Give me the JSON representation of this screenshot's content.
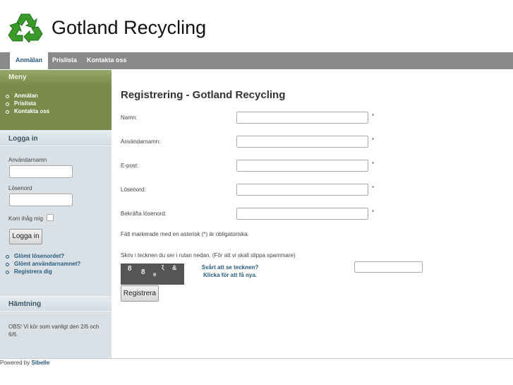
{
  "header": {
    "title": "Gotland Recycling",
    "logo": "recycling-logo"
  },
  "nav": {
    "tabs": [
      {
        "label": "Anmälan",
        "active": true
      },
      {
        "label": "Prislista"
      },
      {
        "label": "Kontakta oss"
      }
    ]
  },
  "sidebar": {
    "menu": {
      "title": "Meny",
      "items": [
        "Anmälan",
        "Prislista",
        "Kontakta oss"
      ]
    },
    "login": {
      "title": "Logga in",
      "username_label": "Användarnamn",
      "username_value": "",
      "password_label": "Lösenord",
      "password_value": "",
      "remember_label": "Kom ihåg mig",
      "remember_checked": false,
      "submit_label": "Logga in",
      "links": [
        "Glömt lösenordet?",
        "Glömt användarnamnet?",
        "Registrera dig"
      ]
    },
    "pickup": {
      "title": "Hämtning",
      "text": "OBS! Vi kör som vanligt den 2/6 och 6/6."
    }
  },
  "main": {
    "title": "Registrering - Gotland Recycling",
    "fields": [
      {
        "label": "Namn:",
        "value": "",
        "required": "*"
      },
      {
        "label": "Användarnamn:",
        "value": "",
        "required": "*"
      },
      {
        "label": "E-post:",
        "value": "",
        "required": "*"
      },
      {
        "label": "Lösenord:",
        "value": "",
        "required": "*"
      },
      {
        "label": "Bekräfta lösenord:",
        "value": "",
        "required": "*"
      }
    ],
    "required_note": "Fält markerade med en asterisk (*) är obligatoriska.",
    "captcha_instruction": "Skriv i tecknen du ser i rutan nedan. (För att vi skall slippa spammare)",
    "captcha_chars": [
      "8",
      "8",
      "e",
      "ξ",
      "&"
    ],
    "captcha_help_1": "Svårt att se tecknen?",
    "captcha_help_2": "Klicka för att få nya.",
    "captcha_value": "",
    "submit_label": "Registrera"
  },
  "footer": {
    "prefix": "Powered by",
    "link": "Sibelle"
  }
}
